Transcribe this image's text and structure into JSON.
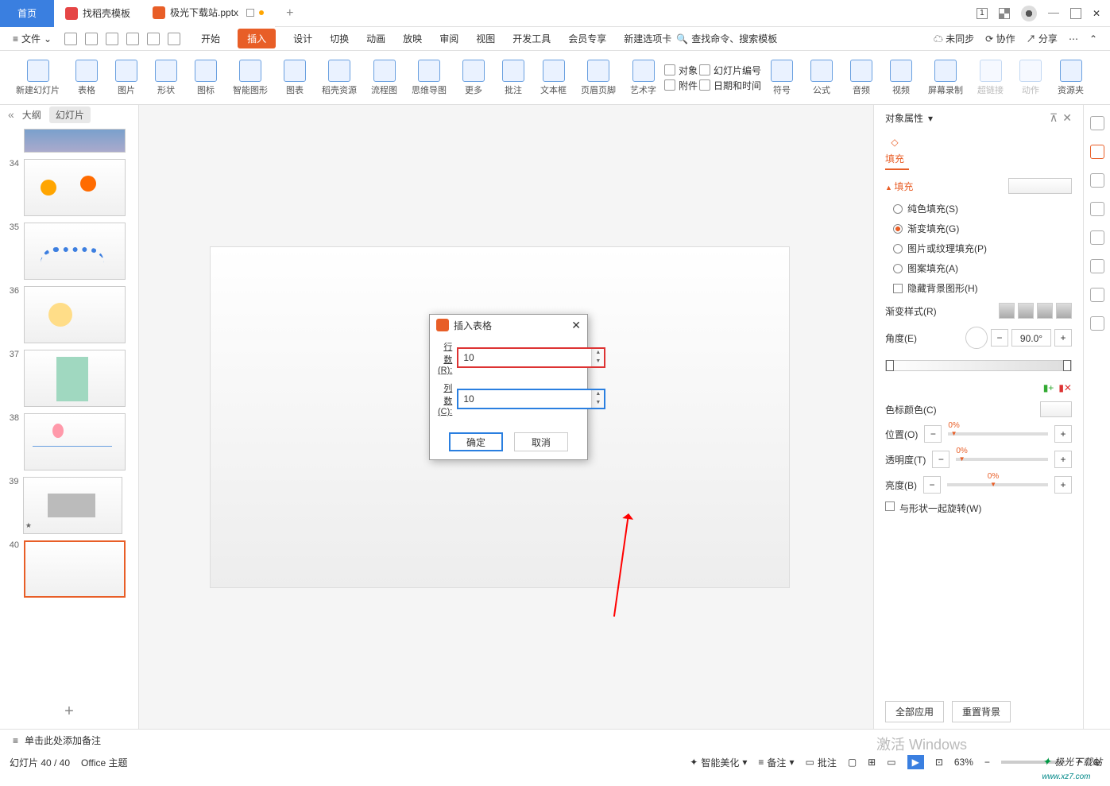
{
  "titlebar": {
    "tabs": [
      {
        "label": "首页"
      },
      {
        "label": "找稻壳模板"
      },
      {
        "label": "极光下载站.pptx"
      }
    ],
    "add": "+"
  },
  "file_menu": "文件",
  "menu": {
    "items": [
      "开始",
      "插入",
      "设计",
      "切换",
      "动画",
      "放映",
      "审阅",
      "视图",
      "开发工具",
      "会员专享",
      "新建选项卡"
    ],
    "active": "插入",
    "search_hint": "查找命令、搜索模板",
    "right": [
      "未同步",
      "协作",
      "分享"
    ]
  },
  "ribbon": [
    {
      "label": "新建幻灯片"
    },
    {
      "label": "表格"
    },
    {
      "label": "图片"
    },
    {
      "label": "形状"
    },
    {
      "label": "图标"
    },
    {
      "label": "智能图形"
    },
    {
      "label": "图表"
    },
    {
      "label": "稻壳资源"
    },
    {
      "label": "流程图"
    },
    {
      "label": "思维导图"
    },
    {
      "label": "更多"
    },
    {
      "label": "批注"
    },
    {
      "label": "文本框"
    },
    {
      "label": "页眉页脚"
    },
    {
      "label": "艺术字"
    },
    {
      "label": "符号"
    },
    {
      "label": "公式"
    },
    {
      "label": "音频"
    },
    {
      "label": "视频"
    },
    {
      "label": "屏幕录制"
    },
    {
      "label": "超链接"
    },
    {
      "label": "动作"
    },
    {
      "label": "资源夹"
    }
  ],
  "ribbon_extra": {
    "object": "对象",
    "slide_number": "幻灯片编号",
    "attachment": "附件",
    "date_time": "日期和时间"
  },
  "outline": {
    "tab_outline": "大纲",
    "tab_slides": "幻灯片",
    "slides": [
      {
        "num": ""
      },
      {
        "num": "34"
      },
      {
        "num": "35"
      },
      {
        "num": "36"
      },
      {
        "num": "37"
      },
      {
        "num": "38"
      },
      {
        "num": "39"
      },
      {
        "num": "40"
      }
    ]
  },
  "notes_placeholder": "单击此处添加备注",
  "modal": {
    "title": "插入表格",
    "rows_label": "行数(R):",
    "cols_label": "列数(C):",
    "rows_value": "10",
    "cols_value": "10",
    "ok": "确定",
    "cancel": "取消"
  },
  "rpanel": {
    "title": "对象属性",
    "fill": "填充",
    "section": "填充",
    "opts": {
      "solid": "纯色填充(S)",
      "gradient": "渐变填充(G)",
      "picture": "图片或纹理填充(P)",
      "pattern": "图案填充(A)",
      "hide_bg": "隐藏背景图形(H)"
    },
    "grad_style": "渐变样式(R)",
    "angle": "角度(E)",
    "angle_val": "90.0°",
    "color_stop": "色标颜色(C)",
    "position": "位置(O)",
    "transparency": "透明度(T)",
    "brightness": "亮度(B)",
    "rotate_with": "与形状一起旋转(W)",
    "pct": "0%",
    "apply_all": "全部应用",
    "reset_bg": "重置背景"
  },
  "statusbar": {
    "slide_info": "幻灯片 40 / 40",
    "theme": "Office 主题",
    "beautify": "智能美化",
    "notes": "备注",
    "comments": "批注",
    "zoom": "63%"
  },
  "activate": "激活 Windows",
  "watermark": "极光下载站"
}
